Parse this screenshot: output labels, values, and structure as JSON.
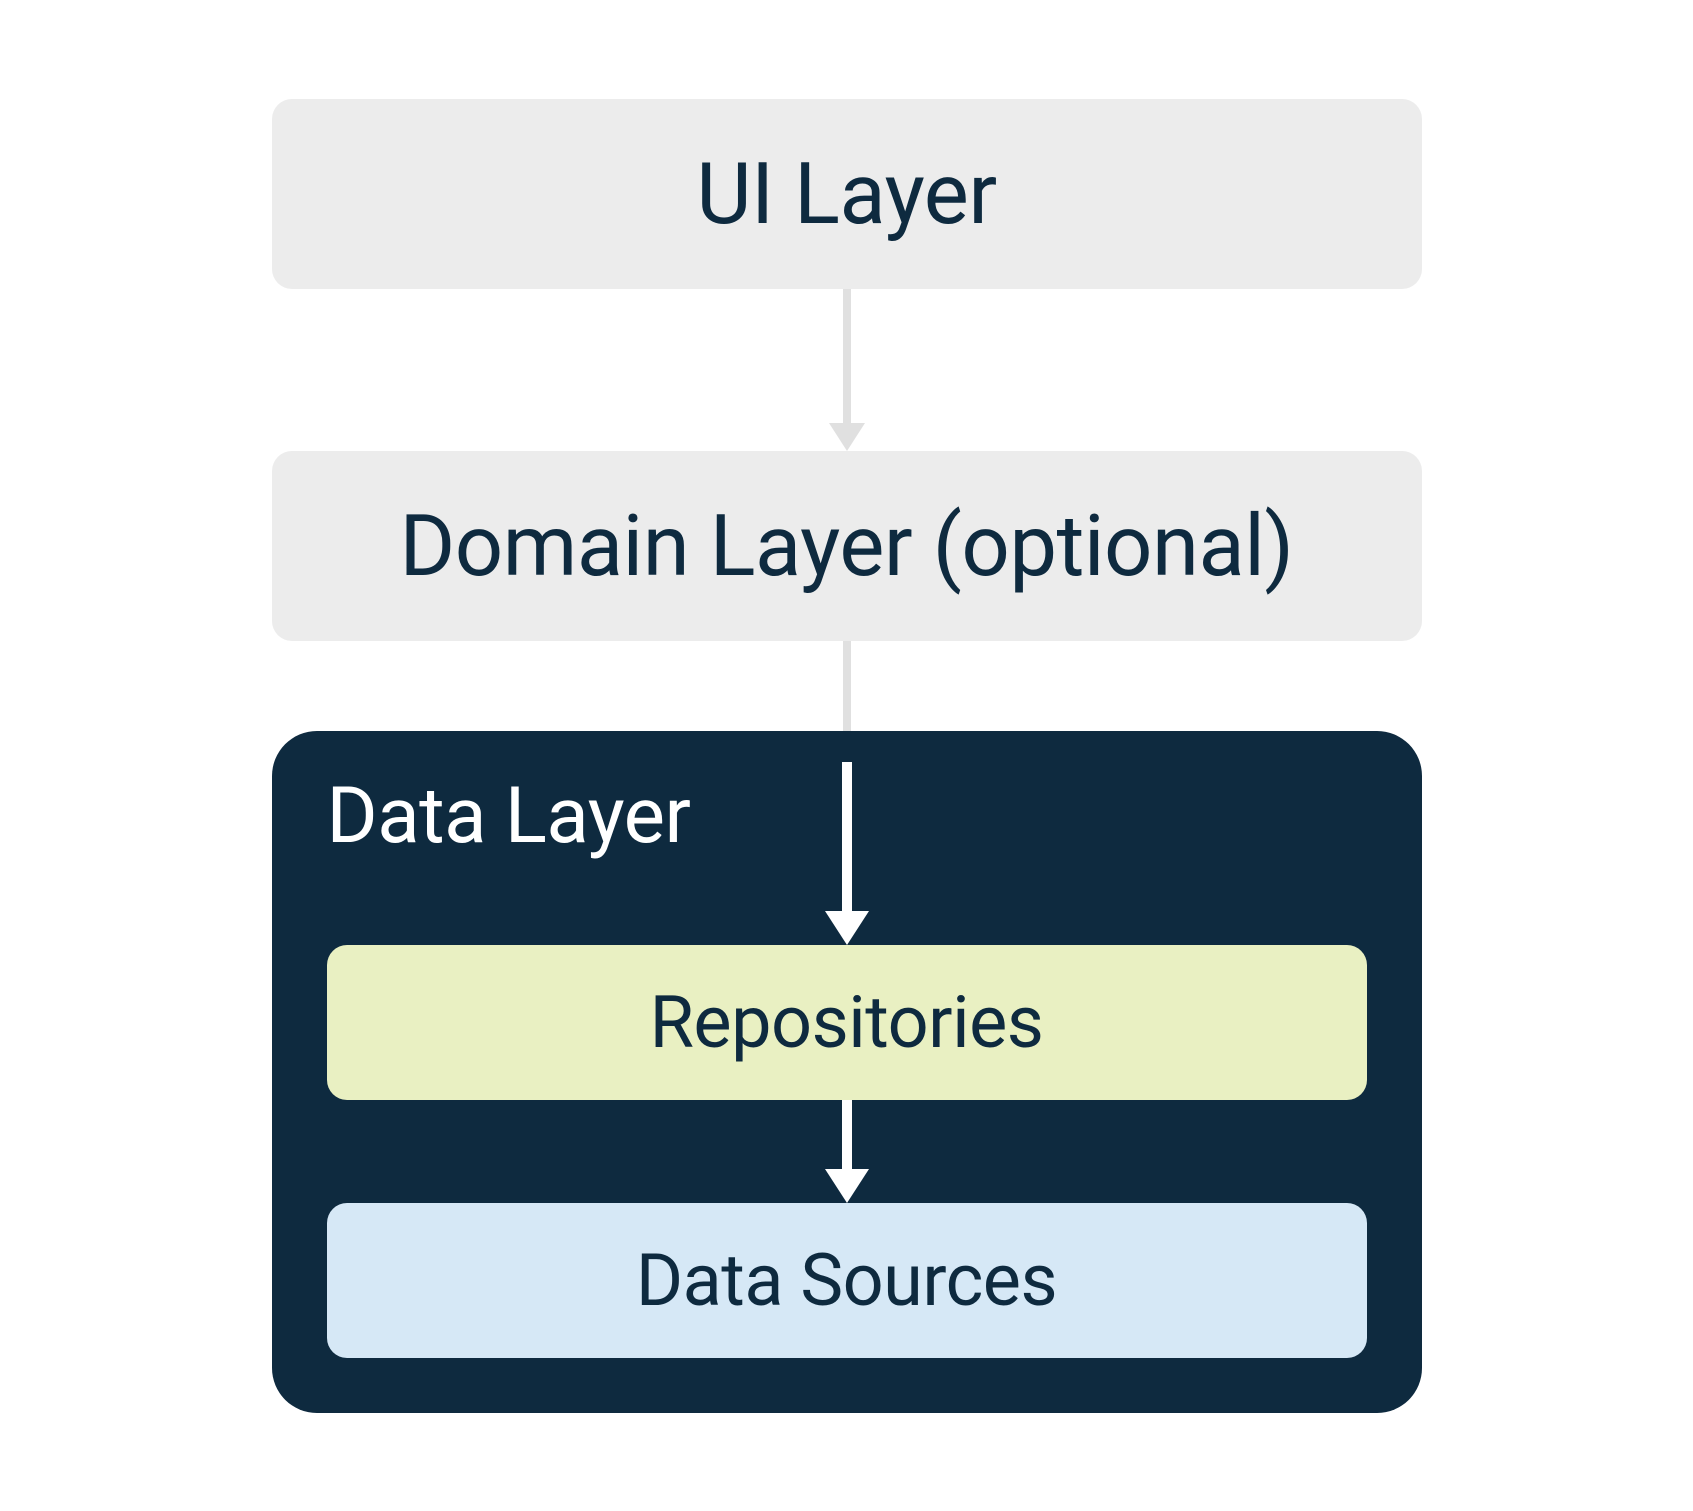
{
  "diagram": {
    "ui_layer": "UI Layer",
    "domain_layer": "Domain Layer (optional)",
    "data_layer": {
      "title": "Data Layer",
      "repositories": "Repositories",
      "data_sources": "Data Sources"
    },
    "colors": {
      "light_gray": "#ececec",
      "dark_navy": "#0e2a3f",
      "pale_yellow_green": "#e9f0c2",
      "pale_blue": "#d6e8f6",
      "arrow_light": "#e0e0e0",
      "arrow_white": "#ffffff"
    }
  }
}
